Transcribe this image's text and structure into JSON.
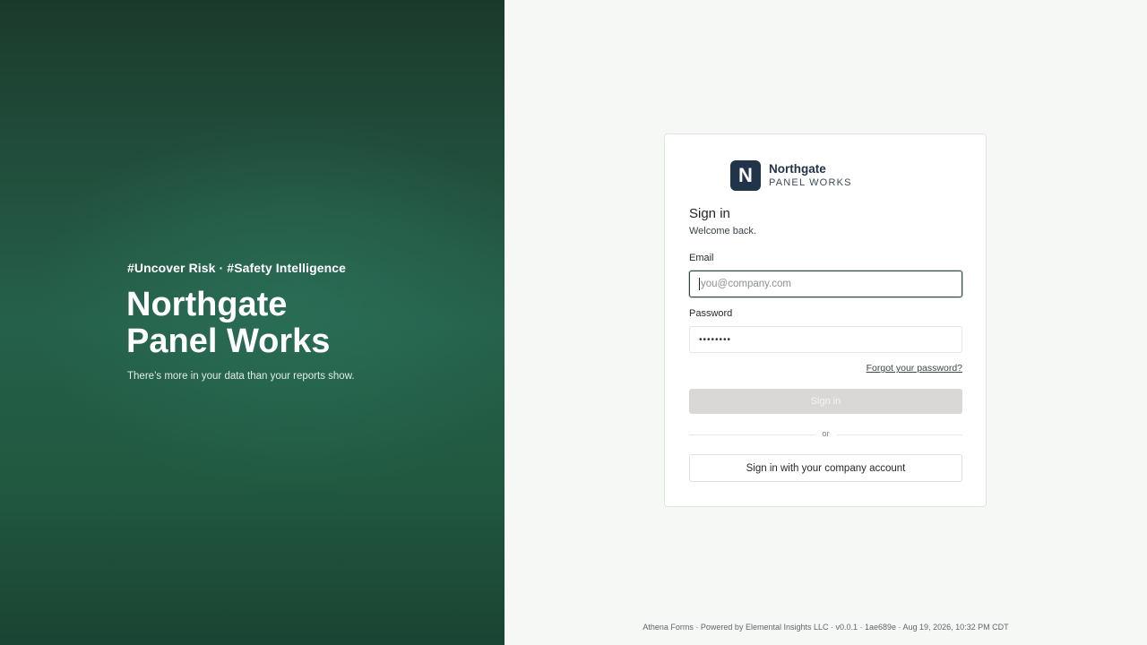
{
  "hero": {
    "tagline": "#Uncover Risk · #Safety Intelligence",
    "title_line1": "Northgate",
    "title_line2": "Panel Works",
    "subtitle": "There’s more in your data than your reports show."
  },
  "brand": {
    "mark_letter": "N",
    "name": "Northgate",
    "tagline": "PANEL WORKS"
  },
  "form": {
    "heading": "Sign in",
    "welcome": "Welcome back.",
    "email_label": "Email",
    "email_placeholder": "you@company.com",
    "password_label": "Password",
    "password_value": "••••••••",
    "forgot_link": "Forgot your password?",
    "signin_button": "Sign in",
    "divider_text": "or",
    "sso_button": "Sign in with your company account"
  },
  "footer": {
    "text": "Athena Forms · Powered by Elemental Insights LLC · v0.0.1 · 1ae689e · Aug 19, 2026, 10:32 PM CDT"
  },
  "colors": {
    "hero_green": "#22523f",
    "brand_navy": "#22344a",
    "disabled_button": "#d9d8d6"
  }
}
